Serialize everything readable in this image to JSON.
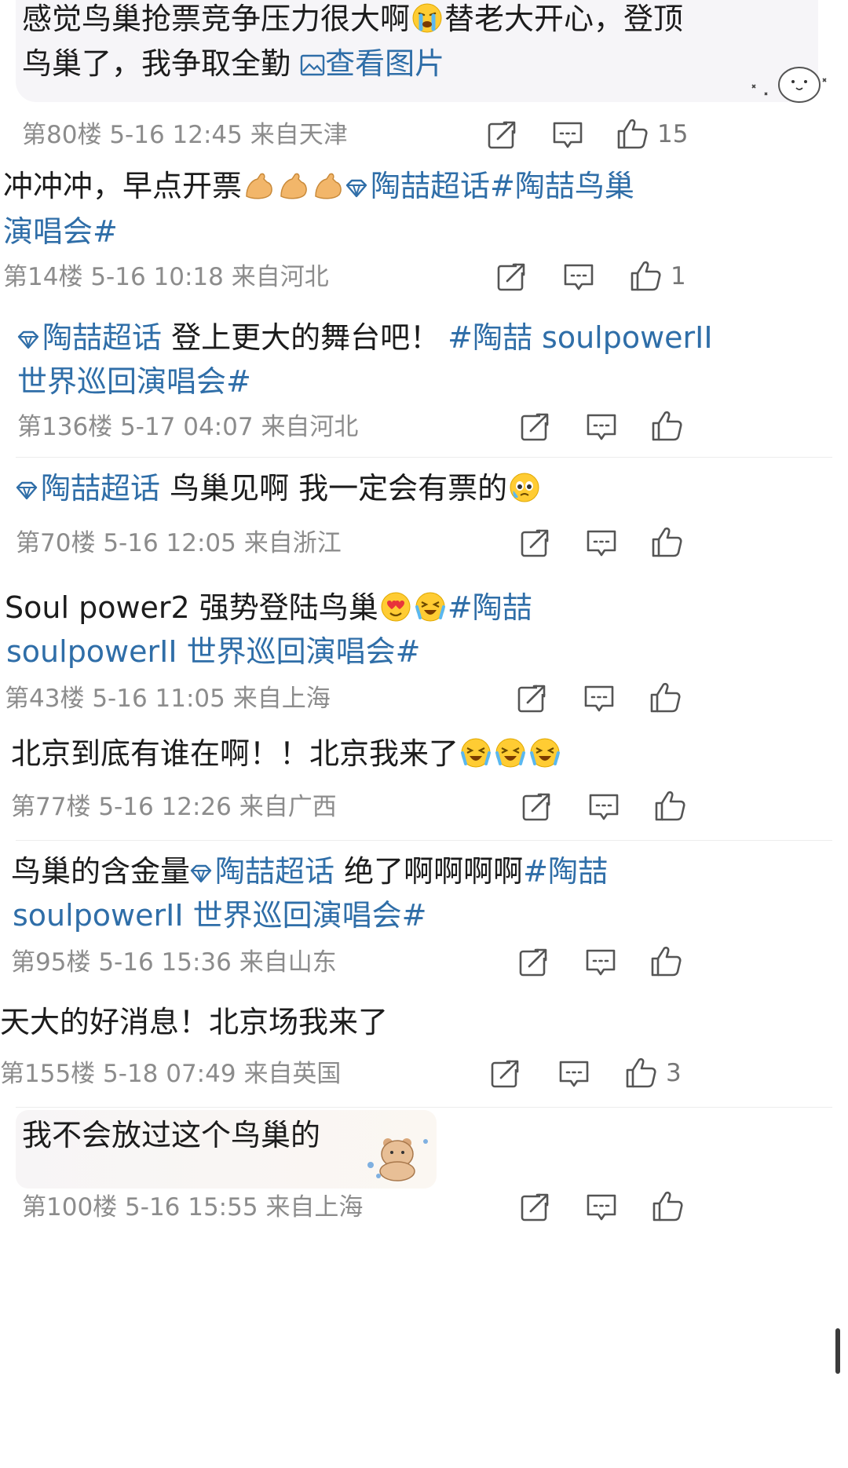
{
  "comments": [
    {
      "text_a": "感觉鸟巢抢票竞争压力很大啊",
      "emoji_a": "crying-face",
      "text_b": "替老大开心，登顶",
      "text_c": "鸟巢了，我争取全勤",
      "link_pic": "查看图片",
      "floor": "第80楼",
      "date": "5-16 12:45",
      "loc": "来自天津",
      "likes": "15"
    },
    {
      "text_a": "冲冲冲，早点开票",
      "emoji_a": "flexed-biceps x3",
      "super_topic": "陶喆超话",
      "hashtag_a": "#陶喆鸟巢",
      "hashtag_b": "演唱会#",
      "floor": "第14楼",
      "date": "5-16 10:18",
      "loc": "来自河北",
      "likes": "1"
    },
    {
      "super_topic": "陶喆超话",
      "text_a": " 登上更大的舞台吧！",
      "hashtag_a": "#陶喆 soulpowerII",
      "hashtag_b": "世界巡回演唱会#",
      "floor": "第136楼",
      "date": "5-17 04:07",
      "loc": "来自河北",
      "likes": ""
    },
    {
      "super_topic": "陶喆超话",
      "text_a": " 鸟巢见啊 我一定会有票的",
      "emoji_a": "tearful-face",
      "floor": "第70楼",
      "date": "5-16 12:05",
      "loc": "来自浙江",
      "likes": ""
    },
    {
      "text_a": "Soul power2 强势登陆鸟巢",
      "emoji_a": "heart-eyes, laughing-tears",
      "hashtag_a": "#陶喆",
      "hashtag_b": "soulpowerII 世界巡回演唱会#",
      "floor": "第43楼",
      "date": "5-16 11:05",
      "loc": "来自上海",
      "likes": ""
    },
    {
      "text_a": "北京到底有谁在啊！！北京我来了",
      "emoji_a": "laughing-tears x3",
      "floor": "第77楼",
      "date": "5-16 12:26",
      "loc": "来自广西",
      "likes": ""
    },
    {
      "text_a": "鸟巢的含金量",
      "super_topic": "陶喆超话",
      "text_b": " 绝了啊啊啊啊",
      "hashtag_a": "#陶喆",
      "hashtag_b": "soulpowerII 世界巡回演唱会#",
      "floor": "第95楼",
      "date": "5-16 15:36",
      "loc": "来自山东",
      "likes": ""
    },
    {
      "text_a": "天大的好消息！北京场我来了",
      "floor": "第155楼",
      "date": "5-18 07:49",
      "loc": "来自英国",
      "likes": "3"
    },
    {
      "text_a": "我不会放过这个鸟巢的",
      "floor": "第100楼",
      "date": "5-16 15:55",
      "loc": "来自上海",
      "likes": ""
    }
  ],
  "colors": {
    "link": "#2f6ea8",
    "meta": "#8c8c8c",
    "text": "#1c1c1c",
    "bubble": "#f6f5f8"
  },
  "icons": {
    "share": "share-icon",
    "comment": "comment-icon",
    "like": "thumbs-up-icon",
    "gem": "super-topic-diamond-icon",
    "image": "image-icon"
  }
}
